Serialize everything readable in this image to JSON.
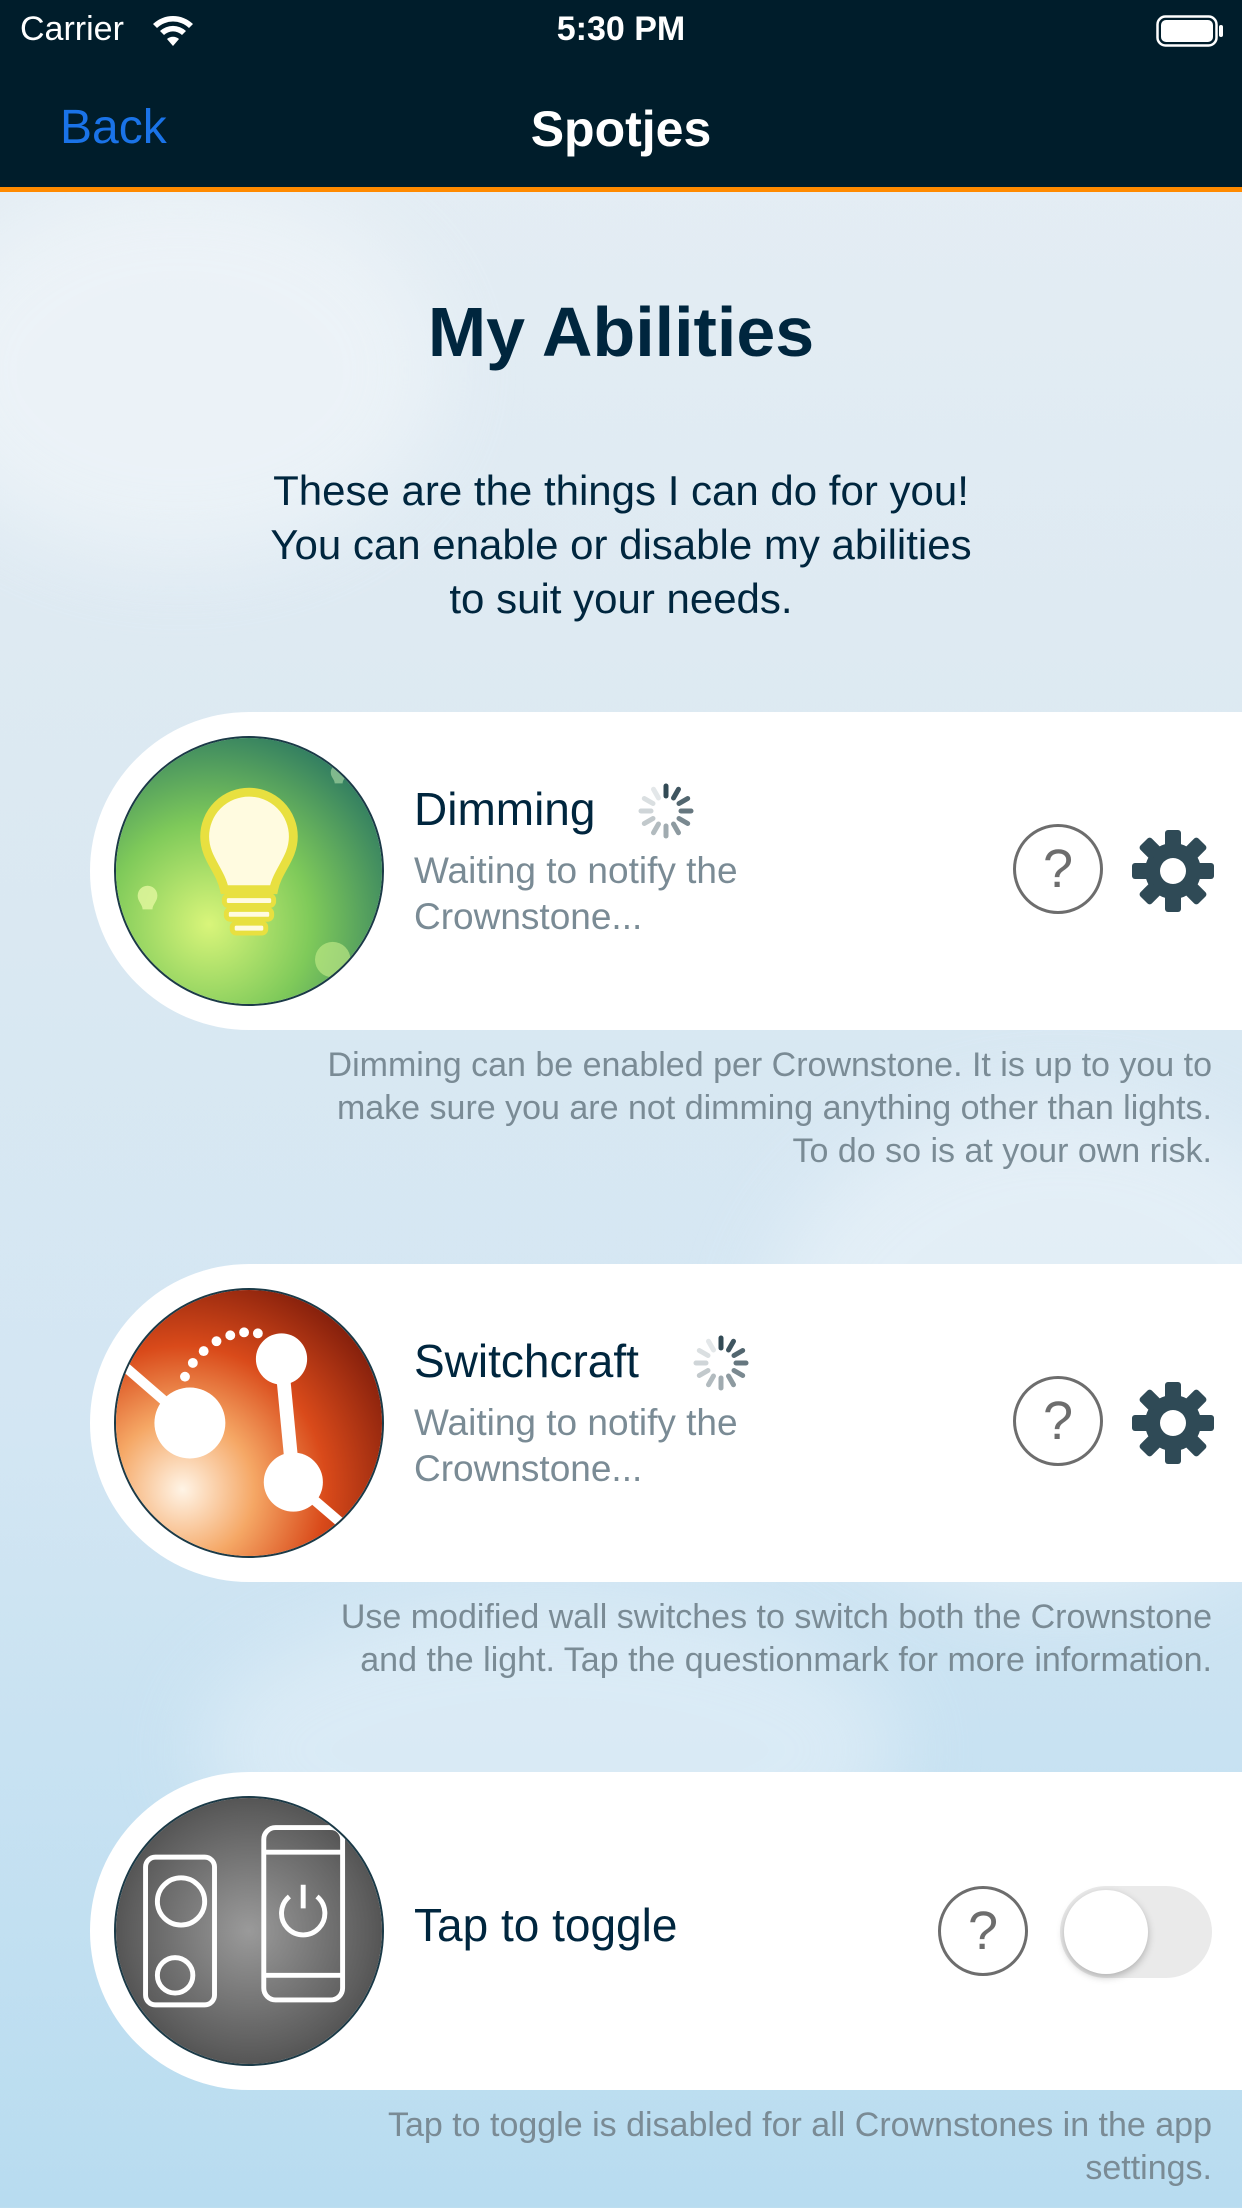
{
  "status_bar": {
    "carrier": "Carrier",
    "time": "5:30 PM"
  },
  "nav": {
    "back_label": "Back",
    "title": "Spotjes",
    "accent_color": "#ff8a00",
    "back_color": "#1a73e8"
  },
  "page": {
    "title": "My Abilities",
    "intro_lines": [
      "These are the things I can do for you!",
      "You can enable or disable my abilities",
      "to suit your needs."
    ]
  },
  "abilities": [
    {
      "name": "Dimming",
      "status_lines": [
        "Waiting to notify the",
        "Crownstone..."
      ],
      "icon": "lightbulb-icon",
      "help_label": "?",
      "control": "settings-gear",
      "description_lines": [
        "Dimming can be enabled per Crownstone. It is up to you to",
        "make sure you are not dimming anything other than lights.",
        "To do so is at your own risk."
      ]
    },
    {
      "name": "Switchcraft",
      "status_lines": [
        "Waiting to notify the",
        "Crownstone..."
      ],
      "icon": "wall-switch-icon",
      "help_label": "?",
      "control": "settings-gear",
      "description_lines": [
        "Use modified wall switches to switch both the Crownstone",
        "and the light. Tap the questionmark for more information."
      ]
    },
    {
      "name": "Tap to toggle",
      "icon": "phone-plug-icon",
      "help_label": "?",
      "control": "toggle",
      "enabled": false,
      "description_lines": [
        "Tap to toggle is disabled for all Crownstones in the app",
        "settings."
      ]
    }
  ]
}
